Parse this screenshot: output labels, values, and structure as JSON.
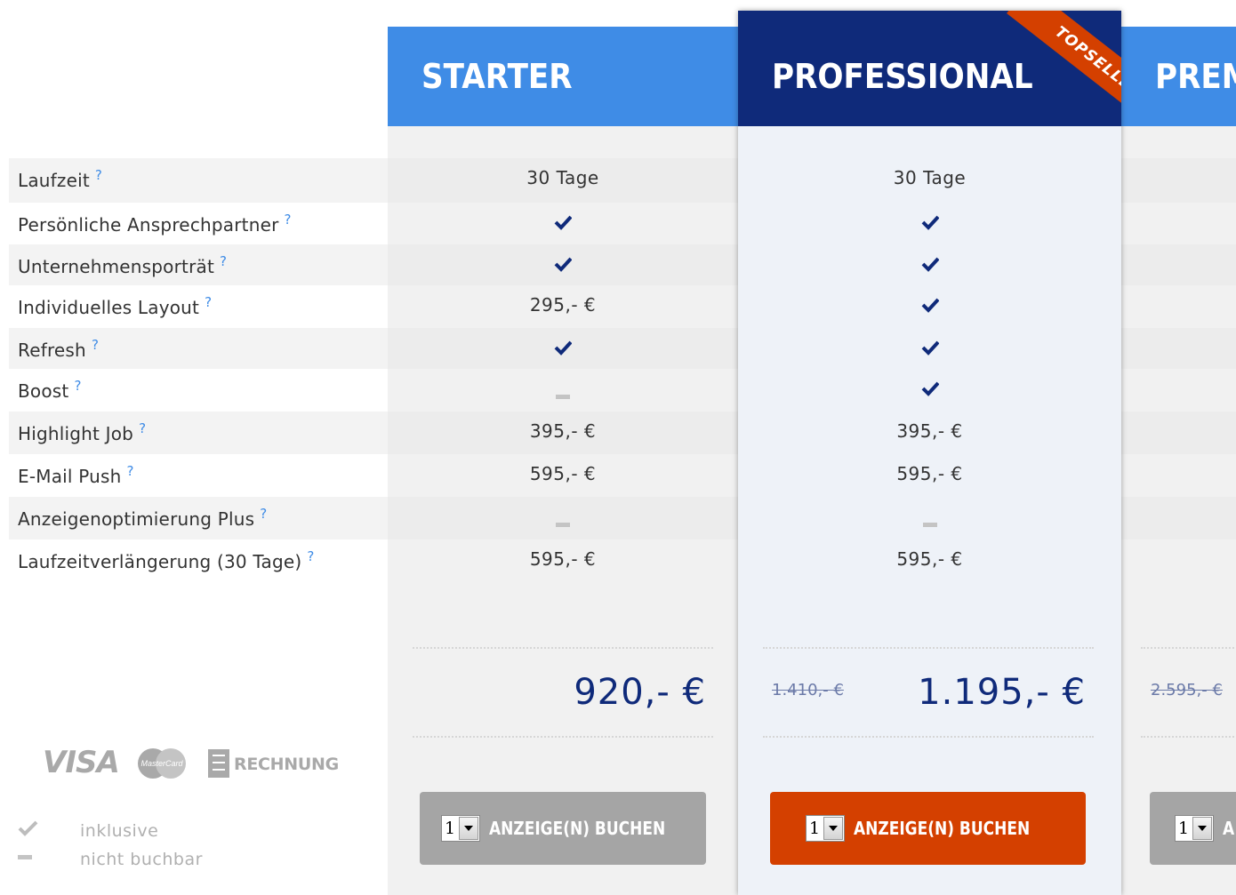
{
  "features": [
    {
      "label": "Laufzeit",
      "help": "?",
      "starter": "30 Tage",
      "pro": "30 Tage"
    },
    {
      "label": "Persönliche Ansprechpartner",
      "help": "?",
      "starter": "check",
      "pro": "check"
    },
    {
      "label": "Unternehmensporträt",
      "help": "?",
      "starter": "check",
      "pro": "check"
    },
    {
      "label": "Individuelles Layout",
      "help": "?",
      "starter": "295,- €",
      "pro": "check"
    },
    {
      "label": "Refresh",
      "help": "?",
      "starter": "check",
      "pro": "check"
    },
    {
      "label": "Boost",
      "help": "?",
      "starter": "dash",
      "pro": "check"
    },
    {
      "label": "Highlight Job",
      "help": "?",
      "starter": "395,- €",
      "pro": "395,- €"
    },
    {
      "label": "E-Mail Push",
      "help": "?",
      "starter": "595,- €",
      "pro": "595,- €"
    },
    {
      "label": "Anzeigenoptimierung Plus",
      "help": "?",
      "starter": "dash",
      "pro": "dash"
    },
    {
      "label": "Laufzeitverlängerung (30 Tage)",
      "help": "?",
      "starter": "595,- €",
      "pro": "595,- €"
    }
  ],
  "plans": {
    "starter": {
      "title": "STARTER",
      "price": "920,- €",
      "qty": "1",
      "button": "ANZEIGE(N) BUCHEN"
    },
    "pro": {
      "title": "PROFESSIONAL",
      "ribbon": "TOPSELLER",
      "old_price": "1.410,- €",
      "price": "1.195,- €",
      "qty": "1",
      "button": "ANZEIGE(N) BUCHEN"
    },
    "premium": {
      "title": "PREM",
      "old_price": "2.595,- €",
      "qty": "1",
      "button": "A"
    }
  },
  "payment": {
    "visa": "VISA",
    "mastercard": "MasterCard",
    "rechnung": "RECHNUNG"
  },
  "legend": {
    "included": "inklusive",
    "not_bookable": "nicht buchbar"
  },
  "colors": {
    "starter_header": "#3f8ce6",
    "pro_header": "#0f2a7a",
    "accent_orange": "#d44000",
    "check": "#0f2a7a"
  }
}
